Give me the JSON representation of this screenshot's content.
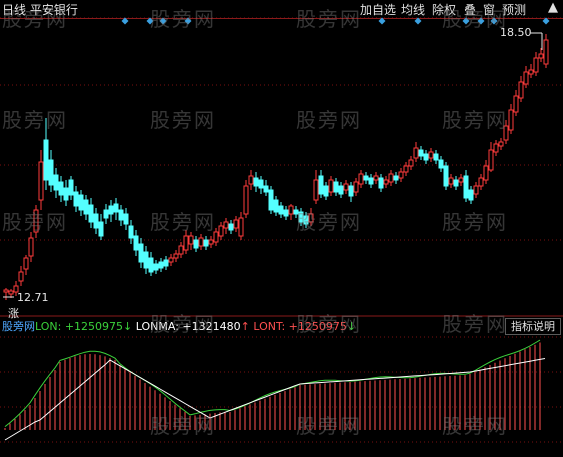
{
  "header": {
    "title": "日线  平安银行",
    "menu": [
      {
        "label": "加自选"
      },
      {
        "label": "均线"
      },
      {
        "label": "除权"
      },
      {
        "label": "叠"
      },
      {
        "label": "窗"
      },
      {
        "label": "预测"
      }
    ],
    "close_glyph": "▲"
  },
  "price_chart": {
    "high_label": "18.50",
    "low_label": "12.71",
    "zhang_label": "涨",
    "colors": {
      "up": "#ff3c3c",
      "down": "#54ffff",
      "marker": "#3aa0e0"
    }
  },
  "indicator": {
    "name": "股旁网",
    "lon_text": "LON: +1250975",
    "lon_arrow": "↓",
    "lonma_text": "LONMA: +1321480",
    "lonma_arrow": "↑",
    "lont_text": "LONT: +1250975",
    "lont_arrow": "↓",
    "help_label": "指标说明",
    "colors": {
      "lon": "#3bd13b",
      "lonma": "#ffffff",
      "lont": "#ff5050"
    }
  },
  "watermark": "股旁网"
}
